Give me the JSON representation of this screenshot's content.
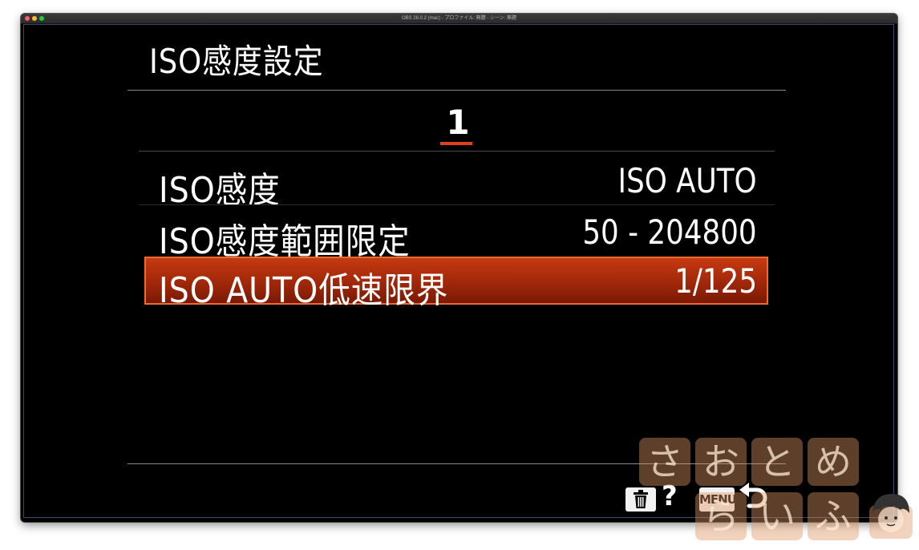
{
  "window": {
    "title": "OBS 26.0.2 (mac) - プロファイル: 無題 - シーン: 無題"
  },
  "menu": {
    "title": "ISO感度設定",
    "page_number": "1",
    "items": [
      {
        "label": "ISO感度",
        "value": "ISO AUTO"
      },
      {
        "label": "ISO感度範囲限定",
        "value": "50 - 204800"
      },
      {
        "label": "ISO AUTO低速限界",
        "value": "1/125"
      }
    ],
    "selected_index": 2
  },
  "footer": {
    "help_label": "?",
    "menu_label": "MENU"
  },
  "watermark": {
    "row1": [
      "さ",
      "お",
      "と",
      "め"
    ],
    "row2": [
      "ら",
      "い",
      "ふ"
    ]
  },
  "colors": {
    "selection": "#a82a0a",
    "selection_border": "#f06a30",
    "page_underline": "#e0401a"
  },
  "icons": [
    "trash-icon",
    "back-arrow-icon"
  ]
}
